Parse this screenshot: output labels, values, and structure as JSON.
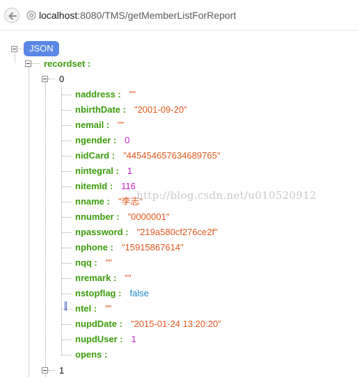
{
  "browser": {
    "url_host": "localhost",
    "url_rest": ":8080/TMS/getMemberListForReport"
  },
  "tree": {
    "root_label": "JSON",
    "recordset_key": "recordset :",
    "index_0": "0",
    "index_1": "1",
    "fields": [
      {
        "key": "naddress :",
        "value": "\"\"",
        "type": "str"
      },
      {
        "key": "nbirthDate :",
        "value": "\"2001-09-20\"",
        "type": "str"
      },
      {
        "key": "nemail :",
        "value": "\"\"",
        "type": "str"
      },
      {
        "key": "ngender :",
        "value": "0",
        "type": "num"
      },
      {
        "key": "nidCard :",
        "value": "\"445454657634689765\"",
        "type": "str"
      },
      {
        "key": "nintegral :",
        "value": "1",
        "type": "num"
      },
      {
        "key": "nitemId :",
        "value": "116",
        "type": "num"
      },
      {
        "key": "nname :",
        "value": "\"李志\"",
        "type": "str"
      },
      {
        "key": "nnumber :",
        "value": "\"0000001\"",
        "type": "str"
      },
      {
        "key": "npassword :",
        "value": "\"219a580cf276ce2f\"",
        "type": "str"
      },
      {
        "key": "nphone :",
        "value": "\"15915867614\"",
        "type": "str"
      },
      {
        "key": "nqq :",
        "value": "\"\"",
        "type": "str"
      },
      {
        "key": "nremark :",
        "value": "\"\"",
        "type": "str"
      },
      {
        "key": "nstopflag :",
        "value": "false",
        "type": "bool"
      },
      {
        "key": "ntel :",
        "value": "\"\"",
        "type": "str"
      },
      {
        "key": "nupdDate :",
        "value": "\"2015-01-24 13:20:20\"",
        "type": "str"
      },
      {
        "key": "nupdUser :",
        "value": "1",
        "type": "num"
      },
      {
        "key": "opens :",
        "value": "",
        "type": "str"
      }
    ]
  },
  "watermark": "http://blog.csdn.net/u010520912",
  "colors": {
    "key": "#3a9c0a",
    "string": "#e2561c",
    "number": "#c321c3",
    "boolean": "#1a86c8",
    "badge": "#5b87e6"
  }
}
